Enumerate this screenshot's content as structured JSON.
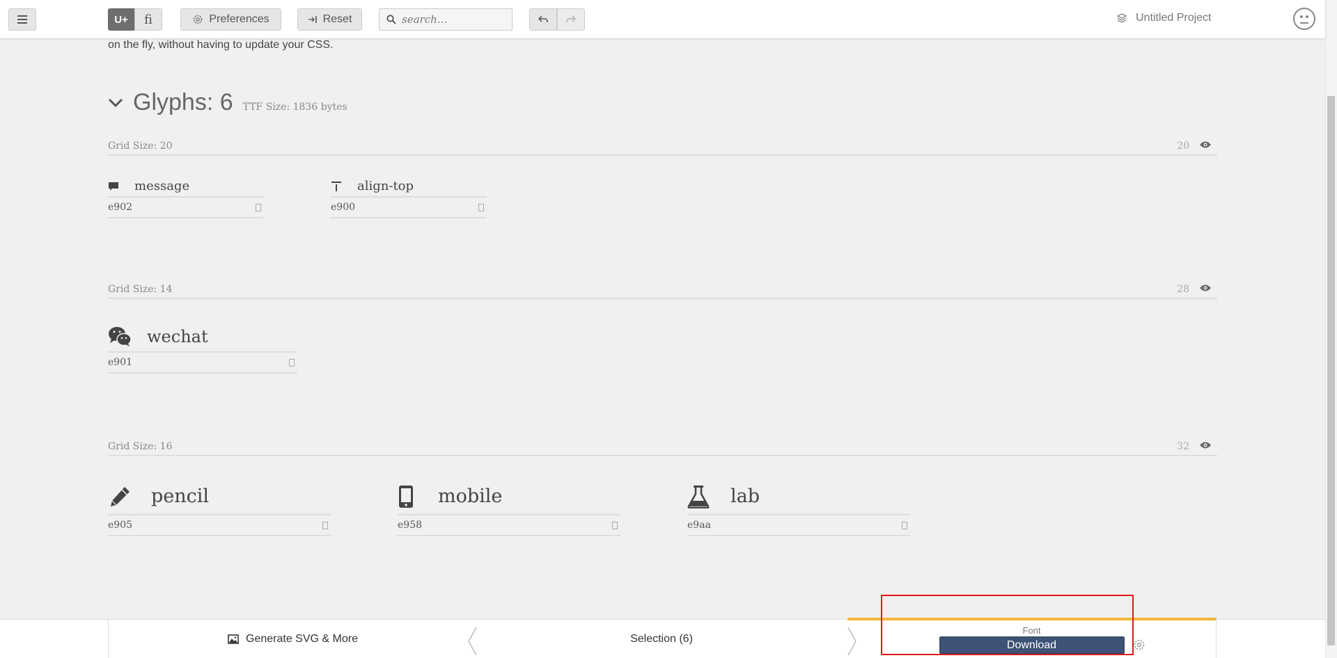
{
  "topbar": {
    "u_label": "U+",
    "fi_label": "fi",
    "preferences_label": "Preferences",
    "reset_label": "Reset",
    "search_placeholder": "search…",
    "project_name": "Untitled Project"
  },
  "intro": {
    "text": "on the fly, without having to update your CSS."
  },
  "glyphs_section": {
    "title": "Glyphs: 6",
    "ttf_size": "TTF Size: 1836 bytes"
  },
  "grids": [
    {
      "label": "Grid Size: 20",
      "value": "20",
      "glyphs": [
        {
          "name": "message",
          "code": "e902",
          "icon": "message-icon"
        },
        {
          "name": "align-top",
          "code": "e900",
          "icon": "align-top-icon"
        }
      ]
    },
    {
      "label": "Grid Size: 14",
      "value": "28",
      "glyphs": [
        {
          "name": "wechat",
          "code": "e901",
          "icon": "wechat-icon"
        }
      ]
    },
    {
      "label": "Grid Size: 16",
      "value": "32",
      "glyphs": [
        {
          "name": "pencil",
          "code": "e905",
          "icon": "pencil-icon"
        },
        {
          "name": "mobile",
          "code": "e958",
          "icon": "mobile-icon"
        },
        {
          "name": "lab",
          "code": "e9aa",
          "icon": "lab-icon"
        }
      ]
    }
  ],
  "bottombar": {
    "generate_label": "Generate SVG & More",
    "selection_label": "Selection (6)",
    "font_label": "Font",
    "download_label": "Download"
  },
  "colors": {
    "accent": "#f0b73a",
    "download_bg": "#3d5276",
    "highlight": "#e01818"
  }
}
